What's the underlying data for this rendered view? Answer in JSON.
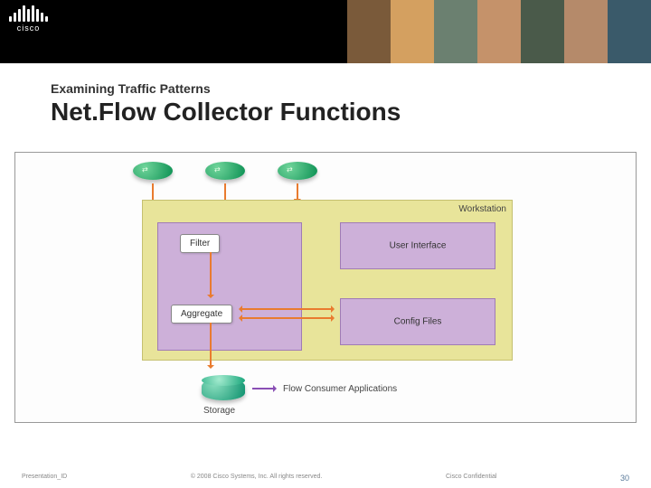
{
  "header": {
    "brand": "cisco"
  },
  "titles": {
    "subtitle": "Examining Traffic Patterns",
    "main": "Net.Flow Collector Functions"
  },
  "diagram": {
    "workstation_label": "Workstation",
    "filter_label": "Filter",
    "aggregate_label": "Aggregate",
    "user_interface_label": "User Interface",
    "config_files_label": "Config Files",
    "storage_label": "Storage",
    "flow_consumer_label": "Flow Consumer Applications"
  },
  "footer": {
    "left": "Presentation_ID",
    "center": "© 2008 Cisco Systems, Inc. All rights reserved.",
    "right": "Cisco Confidential",
    "page": "30"
  }
}
